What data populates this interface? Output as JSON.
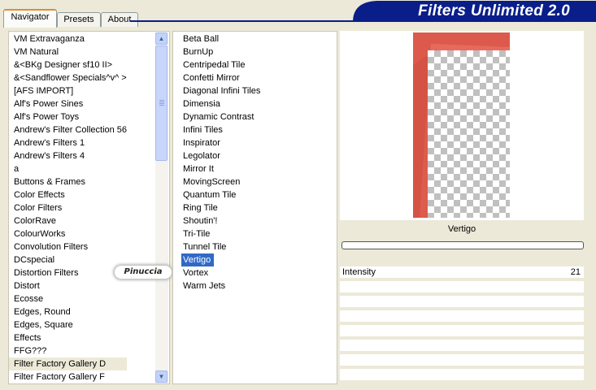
{
  "tabs": [
    {
      "label": "Navigator",
      "active": true
    },
    {
      "label": "Presets",
      "active": false
    },
    {
      "label": "About",
      "active": false
    }
  ],
  "banner": {
    "title": "Filters Unlimited 2.0",
    "color": "#0a1e8a"
  },
  "categories": [
    "VM Extravaganza",
    "VM Natural",
    "&<BKg Designer sf10 II>",
    "&<Sandflower Specials^v^ >",
    "[AFS IMPORT]",
    "Alf's Power Sines",
    "Alf's Power Toys",
    "Andrew's Filter Collection 56",
    "Andrew's Filters 1",
    "Andrew's Filters 4",
    "a",
    "Buttons & Frames",
    "Color Effects",
    "Color Filters",
    "ColorRave",
    "ColourWorks",
    "Convolution Filters",
    "DCspecial",
    "Distortion Filters",
    "Distort",
    "Ecosse",
    "Edges, Round",
    "Edges, Square",
    "Effects",
    "FFG???",
    "Filter Factory Gallery D",
    "Filter Factory Gallery F"
  ],
  "selected_category": "Filter Factory Gallery D",
  "filters": [
    "Beta Ball",
    "BurnUp",
    "Centripedal Tile",
    "Confetti Mirror",
    "Diagonal Infini Tiles",
    "Dimensia",
    "Dynamic Contrast",
    "Infini Tiles",
    "Inspirator",
    "Legolator",
    "Mirror It",
    "MovingScreen",
    "Quantum Tile",
    "Ring Tile",
    "Shoutin'!",
    "Tri-Tile",
    "Tunnel Tile",
    "Vertigo",
    "Vortex",
    "Warm Jets"
  ],
  "selected_filter": "Vertigo",
  "watermark": "Pinuccia",
  "preview": {
    "filter_name": "Vertigo"
  },
  "params": [
    {
      "label": "Intensity",
      "value": "21"
    }
  ],
  "colors": {
    "selection": "#316ac5",
    "preview_red": "#e96a5c"
  }
}
